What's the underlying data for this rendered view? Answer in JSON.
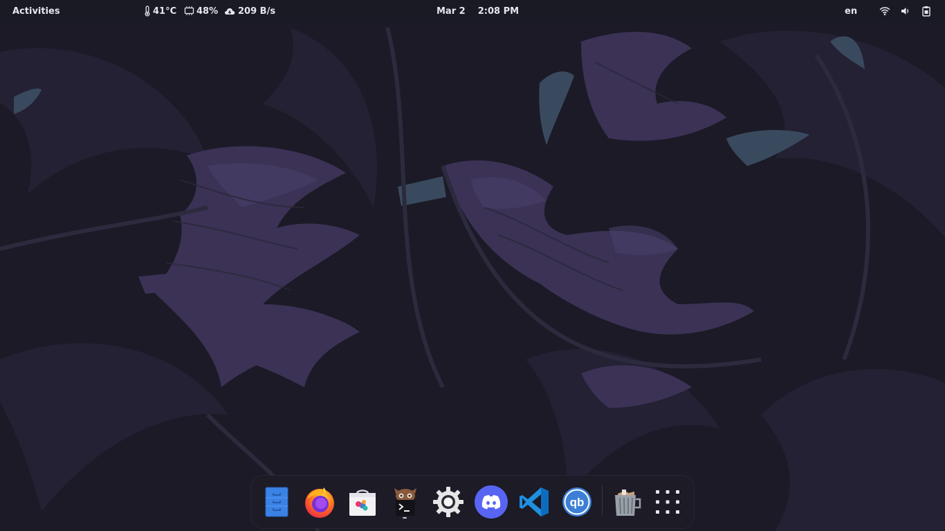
{
  "topbar": {
    "activities_label": "Activities",
    "temperature": "41°C",
    "cpu_usage": "48%",
    "network_speed": "209 B/s",
    "date": "Mar 2",
    "time": "2:08 PM",
    "keyboard_layout": "en",
    "icons": [
      "thermometer-icon",
      "cpu-icon",
      "cloud-download-icon",
      "wifi-icon",
      "volume-icon",
      "clipboard-icon"
    ]
  },
  "dock": {
    "apps": [
      {
        "name": "files",
        "icon": "file-cabinet-icon"
      },
      {
        "name": "firefox",
        "icon": "firefox-icon"
      },
      {
        "name": "software-store",
        "icon": "store-bag-icon"
      },
      {
        "name": "terminal",
        "icon": "terminal-icon",
        "running": true
      },
      {
        "name": "settings",
        "icon": "gear-icon"
      },
      {
        "name": "discord",
        "icon": "discord-icon"
      },
      {
        "name": "vscode",
        "icon": "vscode-icon"
      },
      {
        "name": "qbittorrent",
        "icon": "qbittorrent-icon"
      },
      {
        "name": "trash",
        "icon": "trash-icon"
      },
      {
        "name": "show-apps",
        "icon": "app-grid-icon"
      }
    ]
  },
  "colors": {
    "topbar_bg": "#1a1a24",
    "wallpaper_base": "#1b1a26",
    "leaf_purple": "#3b3256",
    "leaf_teal": "#3a4a5e",
    "dock_bg": "#1c1b26",
    "accent_blue": "#3b82e6",
    "discord": "#5865f2",
    "vscode": "#1f8fe0",
    "qbittorrent": "#3d7fd6"
  }
}
